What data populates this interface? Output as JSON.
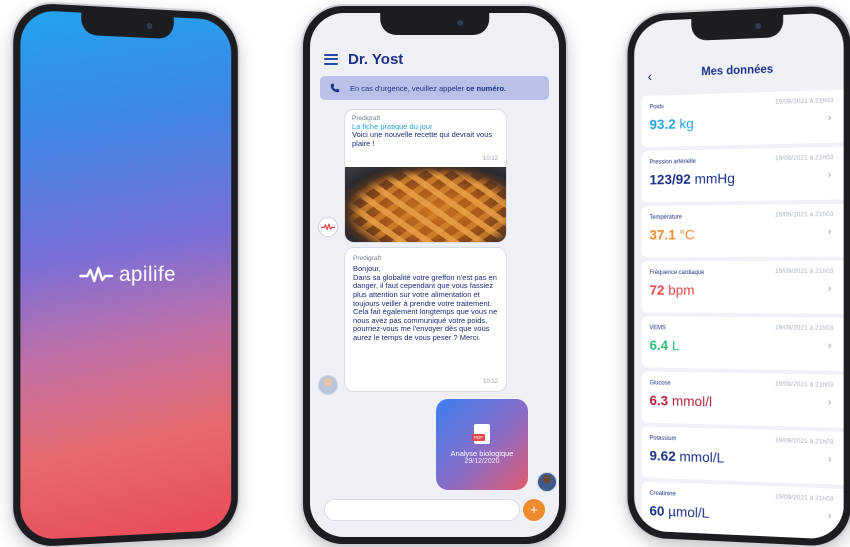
{
  "splash": {
    "brand": "apilife",
    "colors": {
      "top": "#22a3ee",
      "bottom": "#ea4a58"
    }
  },
  "chat": {
    "title": "Dr. Yost",
    "urgence": {
      "text": "En cas d'urgence, veuillez appeler ",
      "link": "ce numéro."
    },
    "messages": [
      {
        "sender": "Predigraft",
        "title": "La fiche pratique du jour",
        "text": "Voici une nouvelle recette qui devrait vous plaire !",
        "time": "10:12"
      },
      {
        "sender": "Predigraft",
        "text": "Bonjour,\nDans sa globalité votre greffon n'est pas en danger, il faut cependant que vous fassiez plus attention sur votre alimentation et toujours veiller à prendre votre traitement. Cela fait également longtemps que vous ne nous avez pas communiqué votre poids, pourriez-vous me l'envoyer dès que vous aurez le temps de vous peser ? Merci.",
        "time": "10:12"
      }
    ],
    "attachment": {
      "badge": "PDF",
      "name": "Analyse biologique",
      "date": "29/12/2020"
    },
    "input_placeholder": "",
    "send_icon": "+"
  },
  "data": {
    "title": "Mes données",
    "back_icon": "‹",
    "items": [
      {
        "label": "Poids",
        "date": "19/09/2021 à 21h03",
        "value": "93.2",
        "unit": "kg",
        "color": "#26a3dd"
      },
      {
        "label": "Pression artérielle",
        "date": "19/09/2021 à 21h03",
        "value": "123/92",
        "unit": "mmHg",
        "color": "#1c3186"
      },
      {
        "label": "Température",
        "date": "19/09/2021 à 21h03",
        "value": "37.1",
        "unit": "°C",
        "color": "#f08a2e"
      },
      {
        "label": "Fréquence cardiaque",
        "date": "19/09/2021 à 21h03",
        "value": "72",
        "unit": "bpm",
        "color": "#e5484d"
      },
      {
        "label": "VEMS",
        "date": "19/09/2021 à 21h03",
        "value": "6.4",
        "unit": "L",
        "color": "#2bbf7a"
      },
      {
        "label": "Glucose",
        "date": "19/09/2021 à 21h03",
        "value": "6.3",
        "unit": "mmol/l",
        "color": "#b3213d"
      },
      {
        "label": "Potassium",
        "date": "19/09/2021 à 21h03",
        "value": "9.62",
        "unit": "mmol/L",
        "color": "#1c3186"
      },
      {
        "label": "Creatinine",
        "date": "19/09/2021 à 21h03",
        "value": "60",
        "unit": "µmol/L",
        "color": "#1c3186"
      }
    ]
  }
}
